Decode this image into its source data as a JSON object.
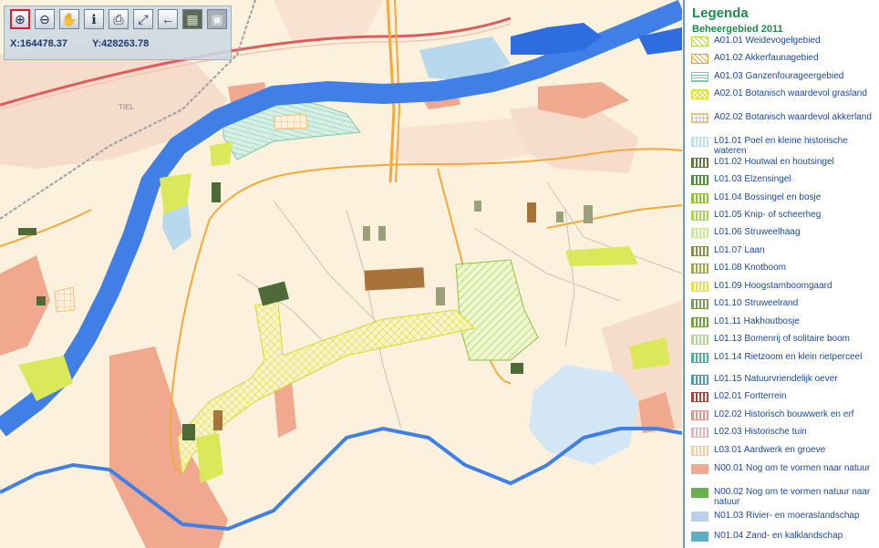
{
  "toolbar": {
    "buttons": [
      {
        "name": "zoom-in",
        "glyph": "⊕"
      },
      {
        "name": "zoom-out",
        "glyph": "⊖"
      },
      {
        "name": "pan",
        "glyph": "✋"
      },
      {
        "name": "info",
        "glyph": "ℹ"
      },
      {
        "name": "print",
        "glyph": "⎙"
      },
      {
        "name": "full-extent",
        "glyph": "⤢"
      },
      {
        "name": "back",
        "glyph": "←"
      },
      {
        "name": "aerial-layer",
        "glyph": "▦"
      },
      {
        "name": "map-layer",
        "glyph": "▣"
      }
    ],
    "x_coord": "X:164478.37",
    "y_coord": "Y:428263.78"
  },
  "map": {
    "town_label": "TIEL",
    "colors": {
      "background": "#fbf1dc",
      "river": "#3f7fe6",
      "water": "#2d6de0",
      "road_orange": "#f4a93a",
      "motorway": "#e45a5a",
      "nature_salmon": "#f0a88f",
      "grass_yellow": "#dbe85a"
    }
  },
  "legend": {
    "title": "Legenda",
    "subtitle": "Beheergebied 2011",
    "items": [
      {
        "label": "A01.01 Weidevogelgebied",
        "color": "#b6d84a",
        "pattern": "hatch"
      },
      {
        "label": "A01.02 Akkerfaunagebied",
        "color": "#e8a040",
        "pattern": "hatch"
      },
      {
        "label": "A01.03 Ganzenfourageergebied",
        "color": "#7fc6a8",
        "pattern": "hlines"
      },
      {
        "label": "A02.01 Botanisch waardevol grasland",
        "color": "#d8df2a",
        "pattern": "cross"
      },
      {
        "label": "A02.02 Botanisch waardevol akkerland",
        "color": "#f0c080",
        "pattern": "grid"
      },
      {
        "label": "L01.01 Poel en kleine historische wateren",
        "color": "#bde0f0",
        "pattern": "vlines"
      },
      {
        "label": "L01.02 Houtwal en houtsingel",
        "color": "#5d7a34",
        "pattern": "vlines"
      },
      {
        "label": "L01.03 Elzensingel",
        "color": "#4d8f3a",
        "pattern": "vlines"
      },
      {
        "label": "L01.04 Bossingel en bosje",
        "color": "#8cc43c",
        "pattern": "vlines"
      },
      {
        "label": "L01.05 Knip- of scheerheg",
        "color": "#a4d84a",
        "pattern": "vlines"
      },
      {
        "label": "L01.06 Struweelhaag",
        "color": "#c8e89a",
        "pattern": "vlines"
      },
      {
        "label": "L01.07 Laan",
        "color": "#8a8a4a",
        "pattern": "vlines"
      },
      {
        "label": "L01.08 Knotboom",
        "color": "#a8a24a",
        "pattern": "vlines"
      },
      {
        "label": "L01.09 Hoogstamboomgaard",
        "color": "#e8e23a",
        "pattern": "vlines"
      },
      {
        "label": "L01.10 Struweelrand",
        "color": "#7a9a5a",
        "pattern": "vlines"
      },
      {
        "label": "L01.11 Hakhoutbosje",
        "color": "#6aa43a",
        "pattern": "vlines"
      },
      {
        "label": "L01.13 Bomenrij of solitaire boom",
        "color": "#b0d890",
        "pattern": "vlines"
      },
      {
        "label": "L01.14 Rietzoom en klein rietperceel",
        "color": "#4ab0a0",
        "pattern": "vlines"
      },
      {
        "label": "L01.15 Natuurvriendelijk oever",
        "color": "#4a9ab8",
        "pattern": "vlines"
      },
      {
        "label": "L02.01 Fortterrein",
        "color": "#a04a3a",
        "pattern": "vlines"
      },
      {
        "label": "L02.02 Historisch bouwwerk en erf",
        "color": "#d89a8a",
        "pattern": "vlines"
      },
      {
        "label": "L02.03 Historische tuin",
        "color": "#e8b0b8",
        "pattern": "vlines"
      },
      {
        "label": "L03.01 Aardwerk en groeve",
        "color": "#f0d0a0",
        "pattern": "vlines"
      },
      {
        "label": "N00.01 Nog om te vormen naar natuur",
        "color": "#f2a994",
        "pattern": "solid"
      },
      {
        "label": "N00.02 Nog om te vormen natuur naar natuur",
        "color": "#6ab04c",
        "pattern": "solid"
      },
      {
        "label": "N01.03 Rivier- en moeraslandschap",
        "color": "#b8d2ec",
        "pattern": "solid"
      },
      {
        "label": "N01.04 Zand- en kalklandschap",
        "color": "#5ab0c0",
        "pattern": "solid"
      }
    ]
  }
}
